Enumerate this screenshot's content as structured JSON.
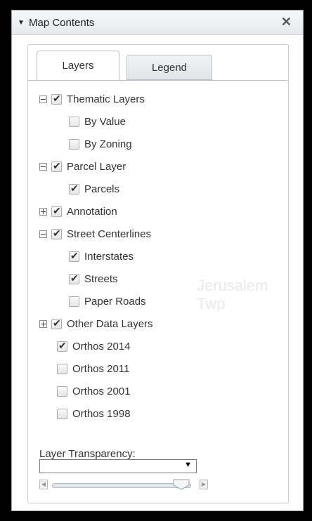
{
  "header": {
    "title": "Map Contents",
    "close_icon": "close-icon",
    "collapse_icon": "triangle-down-icon"
  },
  "tabs": [
    {
      "label": "Layers",
      "active": true
    },
    {
      "label": "Legend",
      "active": false
    }
  ],
  "watermark": {
    "text": "Jerusalem Twp"
  },
  "layers": [
    {
      "label": "Thematic Layers",
      "checked": true,
      "expander": "minus",
      "level": 0
    },
    {
      "label": "By Value",
      "checked": false,
      "expander": null,
      "level": 1
    },
    {
      "label": "By Zoning",
      "checked": false,
      "expander": null,
      "level": 1
    },
    {
      "label": "Parcel Layer",
      "checked": true,
      "expander": "minus",
      "level": 0
    },
    {
      "label": "Parcels",
      "checked": true,
      "expander": null,
      "level": 1
    },
    {
      "label": "Annotation",
      "checked": true,
      "expander": "plus",
      "level": 0
    },
    {
      "label": "Street Centerlines",
      "checked": true,
      "expander": "minus",
      "level": 0
    },
    {
      "label": "Interstates",
      "checked": true,
      "expander": null,
      "level": 1
    },
    {
      "label": "Streets",
      "checked": true,
      "expander": null,
      "level": 1
    },
    {
      "label": "Paper Roads",
      "checked": false,
      "expander": null,
      "level": 1
    },
    {
      "label": "Other Data Layers",
      "checked": true,
      "expander": "plus",
      "level": 0
    },
    {
      "label": "Orthos 2014",
      "checked": true,
      "expander": null,
      "level": 0.5
    },
    {
      "label": "Orthos 2011",
      "checked": false,
      "expander": null,
      "level": 0.5
    },
    {
      "label": "Orthos 2001",
      "checked": false,
      "expander": null,
      "level": 0.5
    },
    {
      "label": "Orthos 1998",
      "checked": false,
      "expander": null,
      "level": 0.5
    }
  ],
  "transparency": {
    "label": "Layer Transparency:",
    "selected": "",
    "slider_value": 0.9
  },
  "colors": {
    "accent": "#7aa7d6",
    "panel_border": "#9aa4ae"
  }
}
